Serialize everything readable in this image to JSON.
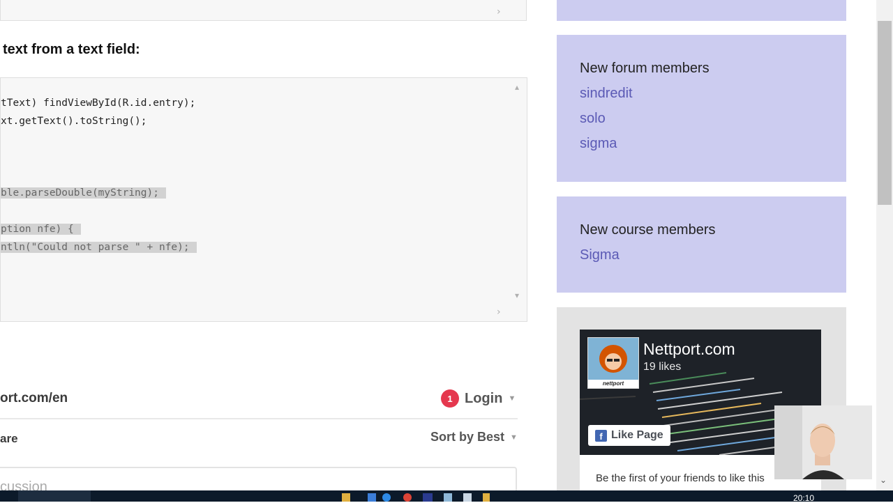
{
  "code": {
    "heading": "text from a text field:",
    "lines": [
      {
        "text": "tText) findViewById(R.id.entry);",
        "selected": false
      },
      {
        "text": "xt.getText().toString();",
        "selected": false
      },
      {
        "text": "ble.parseDouble(myString);",
        "selected": true
      },
      {
        "text": "ption nfe) {",
        "selected": true
      },
      {
        "text": "ntln(\"Could not parse \" + nfe);",
        "selected": true
      }
    ],
    "scroll_right_icon": "chevron-right",
    "scroll_up_icon": "chevron-up",
    "scroll_down_icon": "chevron-down"
  },
  "comments": {
    "site": "ort.com/en",
    "notification_count": "1",
    "login_label": "Login",
    "share_label": "are",
    "sort_label": "Sort by Best",
    "input_placeholder": "cussion"
  },
  "sidebar": {
    "forum": {
      "title": "New forum members",
      "members": [
        "sindredit",
        "solo",
        "sigma"
      ]
    },
    "course": {
      "title": "New course members",
      "members": [
        "Sigma"
      ]
    },
    "facebook": {
      "page_name": "Nettport.com",
      "likes": "19 likes",
      "like_button": "Like Page",
      "friends_text": "Be the first of your friends to like this",
      "avatar_caption": "nettport"
    },
    "accent_color": "#ccccf0",
    "link_color": "#5b5ab5"
  },
  "taskbar": {
    "clock": "20:10"
  }
}
